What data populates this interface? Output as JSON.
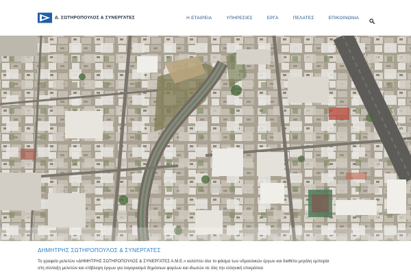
{
  "header": {
    "logo_text": "Δ. ΣΩΤΗΡΟΠΟΥΛΟΣ & ΣΥΝΕΡΓΑΤΕΣ",
    "brand_color": "#1f5fa6",
    "nav": [
      {
        "label": "Η ΕΤΑΙΡΕΙΑ"
      },
      {
        "label": "ΥΠΗΡΕΣΙΕΣ"
      },
      {
        "label": "ΕΡΓΑ"
      },
      {
        "label": "ΠΕΛΑΤΕΣ"
      },
      {
        "label": "ΕΠΙΚΟΙΝΩΝΙΑ"
      }
    ],
    "search_icon": "search-icon"
  },
  "hero": {
    "image": "aerial-city-photo"
  },
  "content": {
    "title": "ΔΗΜΗΤΡΗΣ ΣΩΤΗΡΟΠΟΥΛΟΣ & ΣΥΝΕΡΓΑΤΕΣ",
    "text_line1": "Το γραφείο μελετών «ΔΗΜΗΤΡΗΣ ΣΩΤΗΡΟΠΟΥΛΟΣ & ΣΥΝΕΡΓΑΤΕΣ Α.Μ.Ε.» καλύπτει όλο το φάσμα των υδραυλικών έργων και διαθέτει μεγάλη εμπειρία",
    "text_line2": "στη σύνταξη μελετών και επίβλεψη έργων για λογαριασμό δημόσιων φορέων και ιδιωτών σε όλη την ελληνική επικράτεια",
    "title_color": "#2a7fc1"
  }
}
